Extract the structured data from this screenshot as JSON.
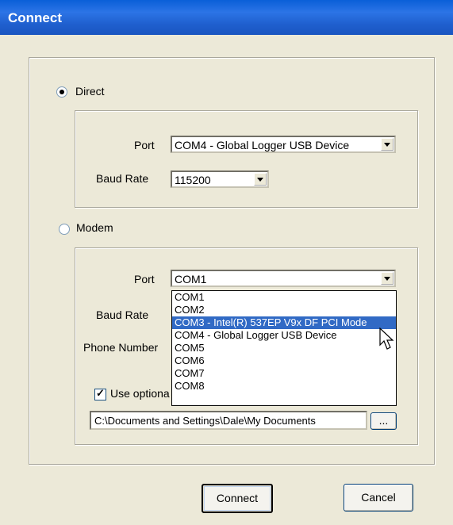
{
  "window": {
    "title": "Connect"
  },
  "direct": {
    "label": "Direct",
    "selected": true,
    "port_label": "Port",
    "port_value": "COM4 - Global Logger USB Device",
    "baud_label": "Baud Rate",
    "baud_value": "115200"
  },
  "modem": {
    "label": "Modem",
    "selected": false,
    "port_label": "Port",
    "port_value": "COM1",
    "baud_label": "Baud Rate",
    "phone_label": "Phone Number",
    "use_optional_label": "Use optiona",
    "use_optional_checked": true,
    "path_value": "C:\\Documents and Settings\\Dale\\My Documents",
    "browse_label": "...",
    "port_options": [
      "COM1",
      "COM2",
      "COM3 - Intel(R) 537EP V9x DF PCI Mode",
      "COM4 - Global Logger USB Device",
      "COM5",
      "COM6",
      "COM7",
      "COM8"
    ],
    "highlighted_option": "COM3 - Intel(R) 537EP V9x DF PCI Mode"
  },
  "buttons": {
    "connect": "Connect",
    "cancel": "Cancel"
  },
  "colors": {
    "titlebar": "#0a5fd8",
    "highlight": "#316ac5",
    "dialog_bg": "#ece9d8"
  }
}
